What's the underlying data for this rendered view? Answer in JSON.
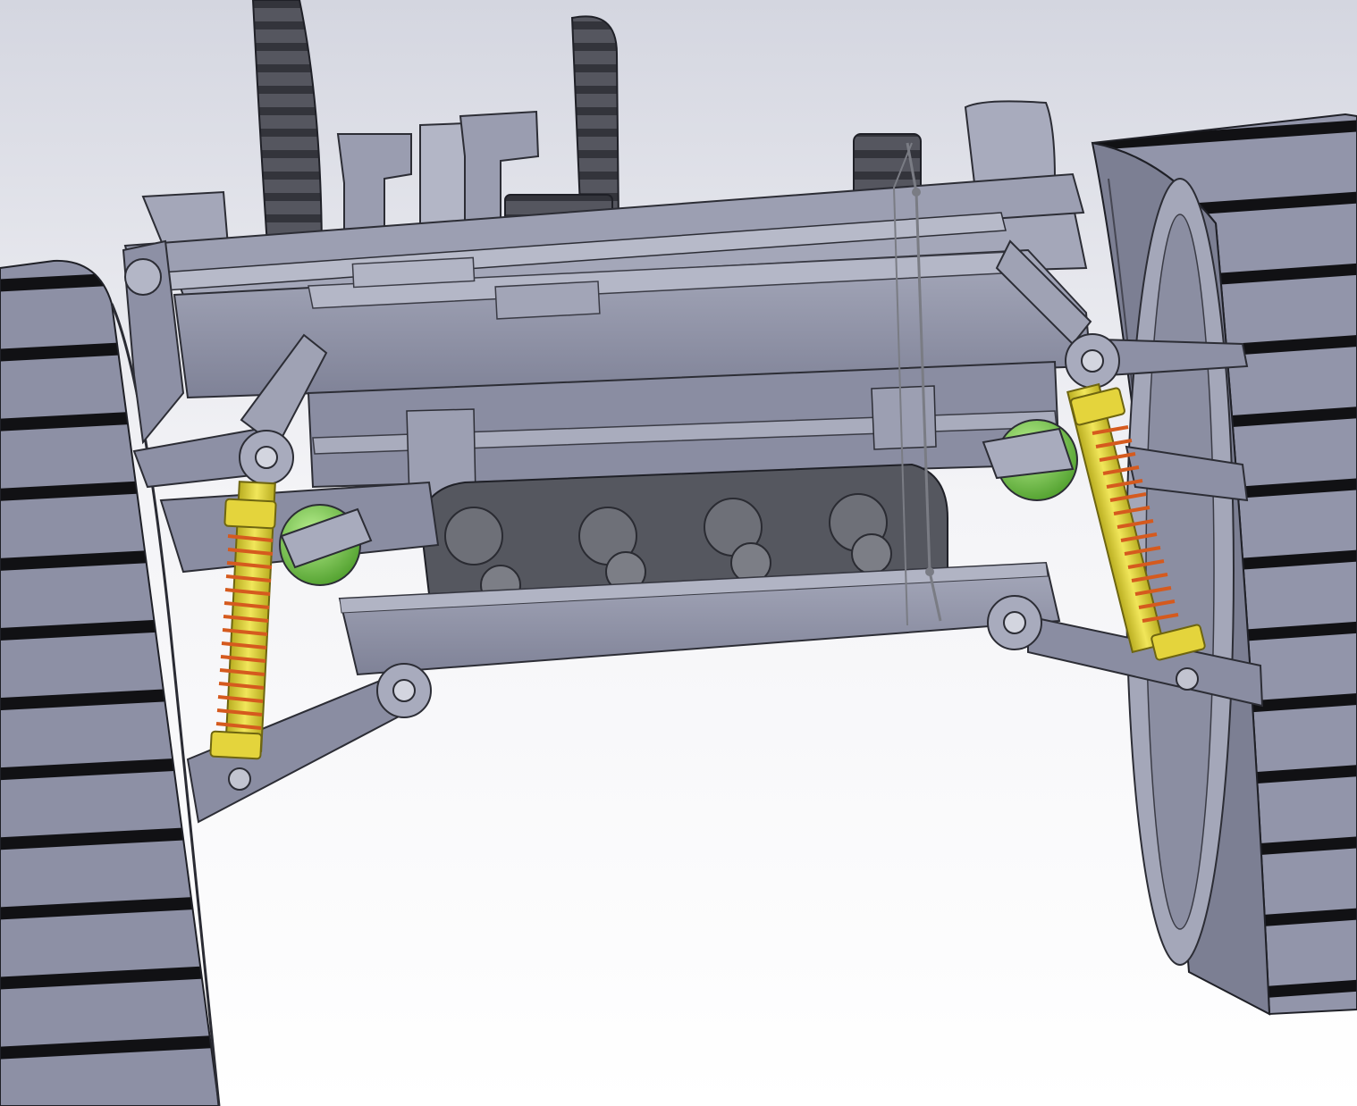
{
  "scene": {
    "subject": "",
    "colors": {
      "background_top": "#d9dbe4",
      "background_bottom": "#ffffff",
      "body": "#8e91a6",
      "body_light": "#a8abbd",
      "body_dark": "#6d7084",
      "outline": "#2c2d35",
      "track": "#1a1a1f",
      "track_rim": "#9a9db0",
      "spring": "#d55a1e",
      "damper": "#e0d23a",
      "ball_joint": "#7ecf52",
      "gear": "#4a4b55"
    }
  }
}
